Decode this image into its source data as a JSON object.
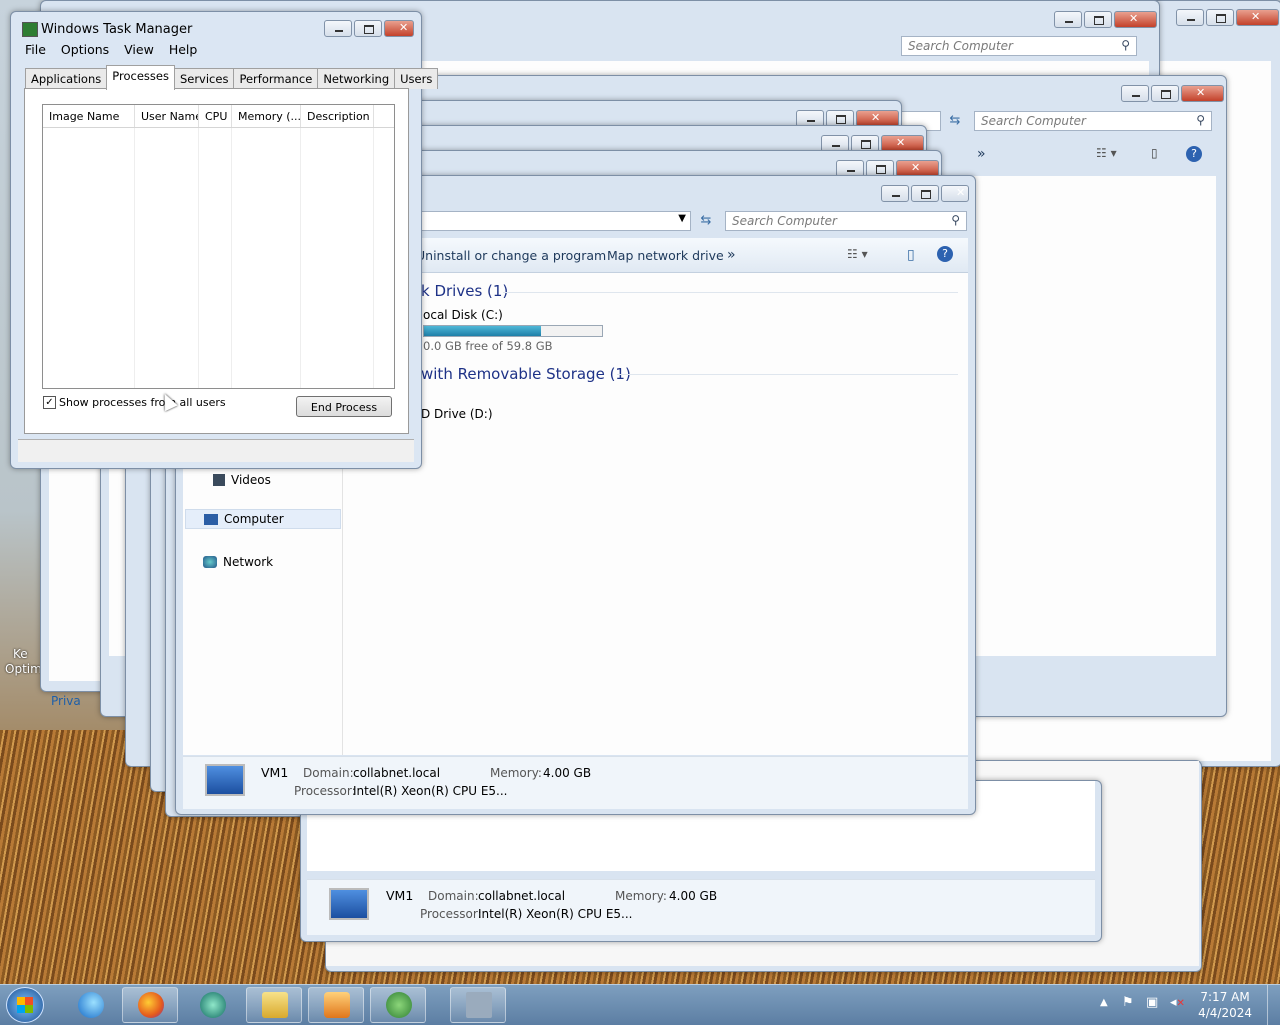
{
  "task_manager": {
    "title": "Windows Task Manager",
    "menu": [
      "File",
      "Options",
      "View",
      "Help"
    ],
    "tabs": [
      "Applications",
      "Processes",
      "Services",
      "Performance",
      "Networking",
      "Users"
    ],
    "active_tab": "Processes",
    "columns": [
      "Image Name",
      "User Name",
      "CPU",
      "Memory (...",
      "Description"
    ],
    "show_all_label": "Show processes from all users",
    "show_all_checked": true,
    "end_process_label": "End Process"
  },
  "explorer": {
    "search_placeholder": "Search Computer",
    "toolbar": {
      "uninstall": "Uninstall or change a program",
      "map_drive": "Map network drive",
      "more": "»"
    },
    "sections": {
      "hard_drives": "k Drives (1)",
      "removable": "with Removable Storage (1)"
    },
    "drives": {
      "c_name": "ocal Disk (C:)",
      "c_free": "0.0 GB free of 59.8 GB",
      "c_used_fraction": 0.66,
      "d_name": "D Drive (D:)"
    },
    "nav": {
      "videos": "Videos",
      "computer": "Computer",
      "network": "Network"
    },
    "details": {
      "name": "VM1",
      "domain_label": "Domain:",
      "domain": "collabnet.local",
      "memory_label": "Memory:",
      "memory": "4.00 GB",
      "processor_label": "Processor:",
      "processor": "Intel(R) Xeon(R) CPU E5..."
    }
  },
  "desktop": {
    "icon_labels": [
      "Ke",
      "Optim",
      "Priva"
    ]
  },
  "taskbar": {
    "time": "7:17 AM",
    "date": "4/4/2024"
  }
}
